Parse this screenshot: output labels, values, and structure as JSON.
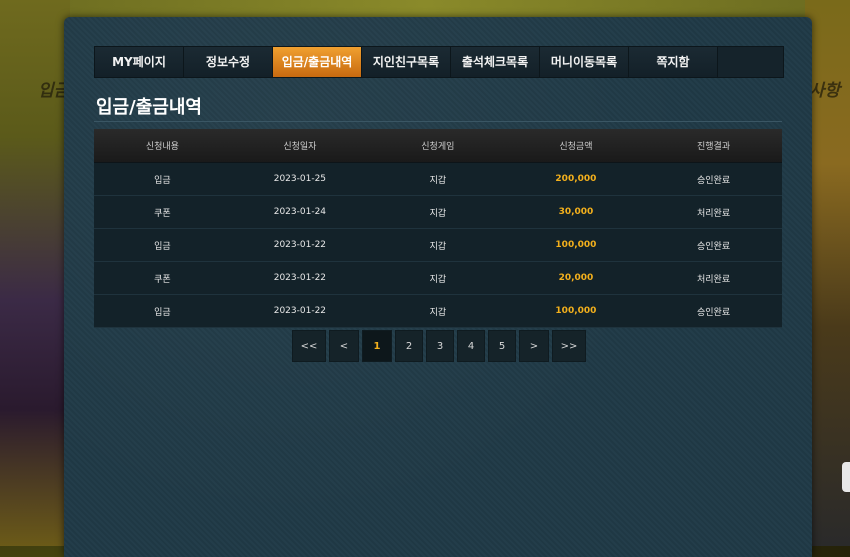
{
  "background": {
    "left_text": "입금",
    "right_text": "사항"
  },
  "tabs": [
    {
      "label": "MY페이지",
      "active": false
    },
    {
      "label": "정보수정",
      "active": false
    },
    {
      "label": "입금/출금내역",
      "active": true
    },
    {
      "label": "지인친구목록",
      "active": false
    },
    {
      "label": "출석체크목록",
      "active": false
    },
    {
      "label": "머니이동목록",
      "active": false
    },
    {
      "label": "쪽지함",
      "active": false
    }
  ],
  "page": {
    "title": "입금/출금내역"
  },
  "table": {
    "headers": [
      "신청내용",
      "신청일자",
      "신청게임",
      "신청금액",
      "진행결과"
    ],
    "rows": [
      [
        "입금",
        "2023-01-25",
        "지갑",
        "200,000",
        "승인완료"
      ],
      [
        "쿠폰",
        "2023-01-24",
        "지갑",
        "30,000",
        "처리완료"
      ],
      [
        "입금",
        "2023-01-22",
        "지갑",
        "100,000",
        "승인완료"
      ],
      [
        "쿠폰",
        "2023-01-22",
        "지갑",
        "20,000",
        "처리완료"
      ],
      [
        "입금",
        "2023-01-22",
        "지갑",
        "100,000",
        "승인완료"
      ]
    ]
  },
  "pagination": {
    "first": "<<",
    "prev": "<",
    "pages": [
      "1",
      "2",
      "3",
      "4",
      "5"
    ],
    "current": "1",
    "next": ">",
    "last": ">>"
  },
  "colors": {
    "accent": "#e0891f",
    "amount": "#f3b01c",
    "panel": "#203a47"
  }
}
